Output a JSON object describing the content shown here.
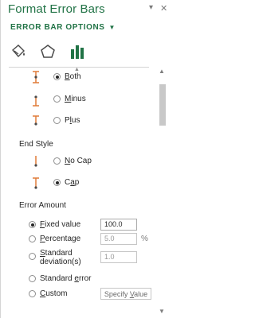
{
  "pane": {
    "title": "Format Error Bars",
    "pin_glyph": "▾",
    "close_glyph": "✕",
    "section_dropdown": "ERROR BAR OPTIONS",
    "section_chevron": "▼",
    "colors": {
      "accent": "#217346",
      "text": "#262626",
      "icon": "#e07b39",
      "tab_icon": "#217346"
    }
  },
  "tabs": [
    {
      "name": "fill-line-tab",
      "icon": "paint-bucket-icon"
    },
    {
      "name": "effects-tab",
      "icon": "pentagon-icon"
    },
    {
      "name": "error-bar-options-tab",
      "icon": "bar-chart-icon"
    }
  ],
  "direction": {
    "options": [
      {
        "pre": "",
        "key": "B",
        "post": "oth",
        "selected": true
      },
      {
        "pre": "",
        "key": "M",
        "post": "inus",
        "selected": false
      },
      {
        "pre": "P",
        "key": "l",
        "post": "us",
        "selected": false
      }
    ]
  },
  "end_style": {
    "heading": "End Style",
    "options": [
      {
        "pre": "",
        "key": "N",
        "post": "o Cap",
        "selected": false
      },
      {
        "pre": "C",
        "key": "a",
        "post": "p",
        "selected": true
      }
    ]
  },
  "error_amount": {
    "heading": "Error Amount",
    "fixed": {
      "pre": "",
      "key": "F",
      "post": "ixed value",
      "value": "100.0",
      "selected": true
    },
    "percentage": {
      "pre": "",
      "key": "P",
      "post": "ercentage",
      "value": "5.0",
      "unit": "%",
      "selected": false
    },
    "stddev": {
      "line1_pre": "",
      "line1_key": "S",
      "line1_post": "tandard",
      "line2": "deviation(s)",
      "value": "1.0",
      "selected": false
    },
    "stderr": {
      "pre": "Standard ",
      "key": "e",
      "post": "rror",
      "selected": false
    },
    "custom": {
      "pre": "",
      "key": "C",
      "post": "ustom",
      "button_pre": "Specify ",
      "button_key": "V",
      "button_post": "alue",
      "selected": false
    }
  }
}
